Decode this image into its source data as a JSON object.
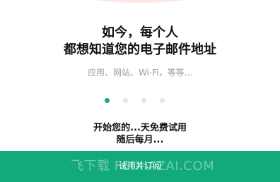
{
  "intro": {
    "headline_line1": "如今，每个人",
    "headline_line2": "都想知道您的电子邮件地址",
    "subtitle": "应用、网站、Wi-Fi，等等..."
  },
  "pager": {
    "total": 4,
    "active_index": 0
  },
  "offer": {
    "line1": "开始您的...天免费试用",
    "line2": "随后每月..."
  },
  "cta": {
    "label": "试用并订阅"
  },
  "watermark": {
    "text": "飞下载 FEIXIAZAI.COM"
  },
  "colors": {
    "accent": "#12a97b",
    "active_dot": "#13ab7a",
    "inactive_dot": "#e3e4ea",
    "top_art": "#fbe8e3"
  }
}
